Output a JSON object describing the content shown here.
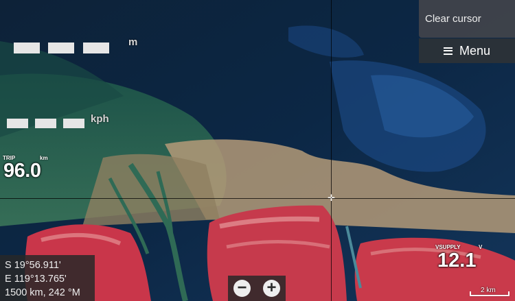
{
  "map": {
    "type": "satellite-chart"
  },
  "gauges": {
    "depth_unit": "m",
    "speed_unit": "kph"
  },
  "trip": {
    "label": "TRIP",
    "unit": "km",
    "value": "96.0"
  },
  "buttons": {
    "clear_cursor": "Clear cursor",
    "menu": "Menu"
  },
  "coords": {
    "lat": "S  19°56.911'",
    "lon": "E 119°13.765'",
    "range_bearing": "1500 km, 242 °M"
  },
  "zoom": {
    "out_icon": "minus-icon",
    "in_icon": "plus-icon"
  },
  "vsupply": {
    "label": "VSUPPLY",
    "unit": "V",
    "value": "12.1"
  },
  "scale": {
    "label": "2 km"
  }
}
